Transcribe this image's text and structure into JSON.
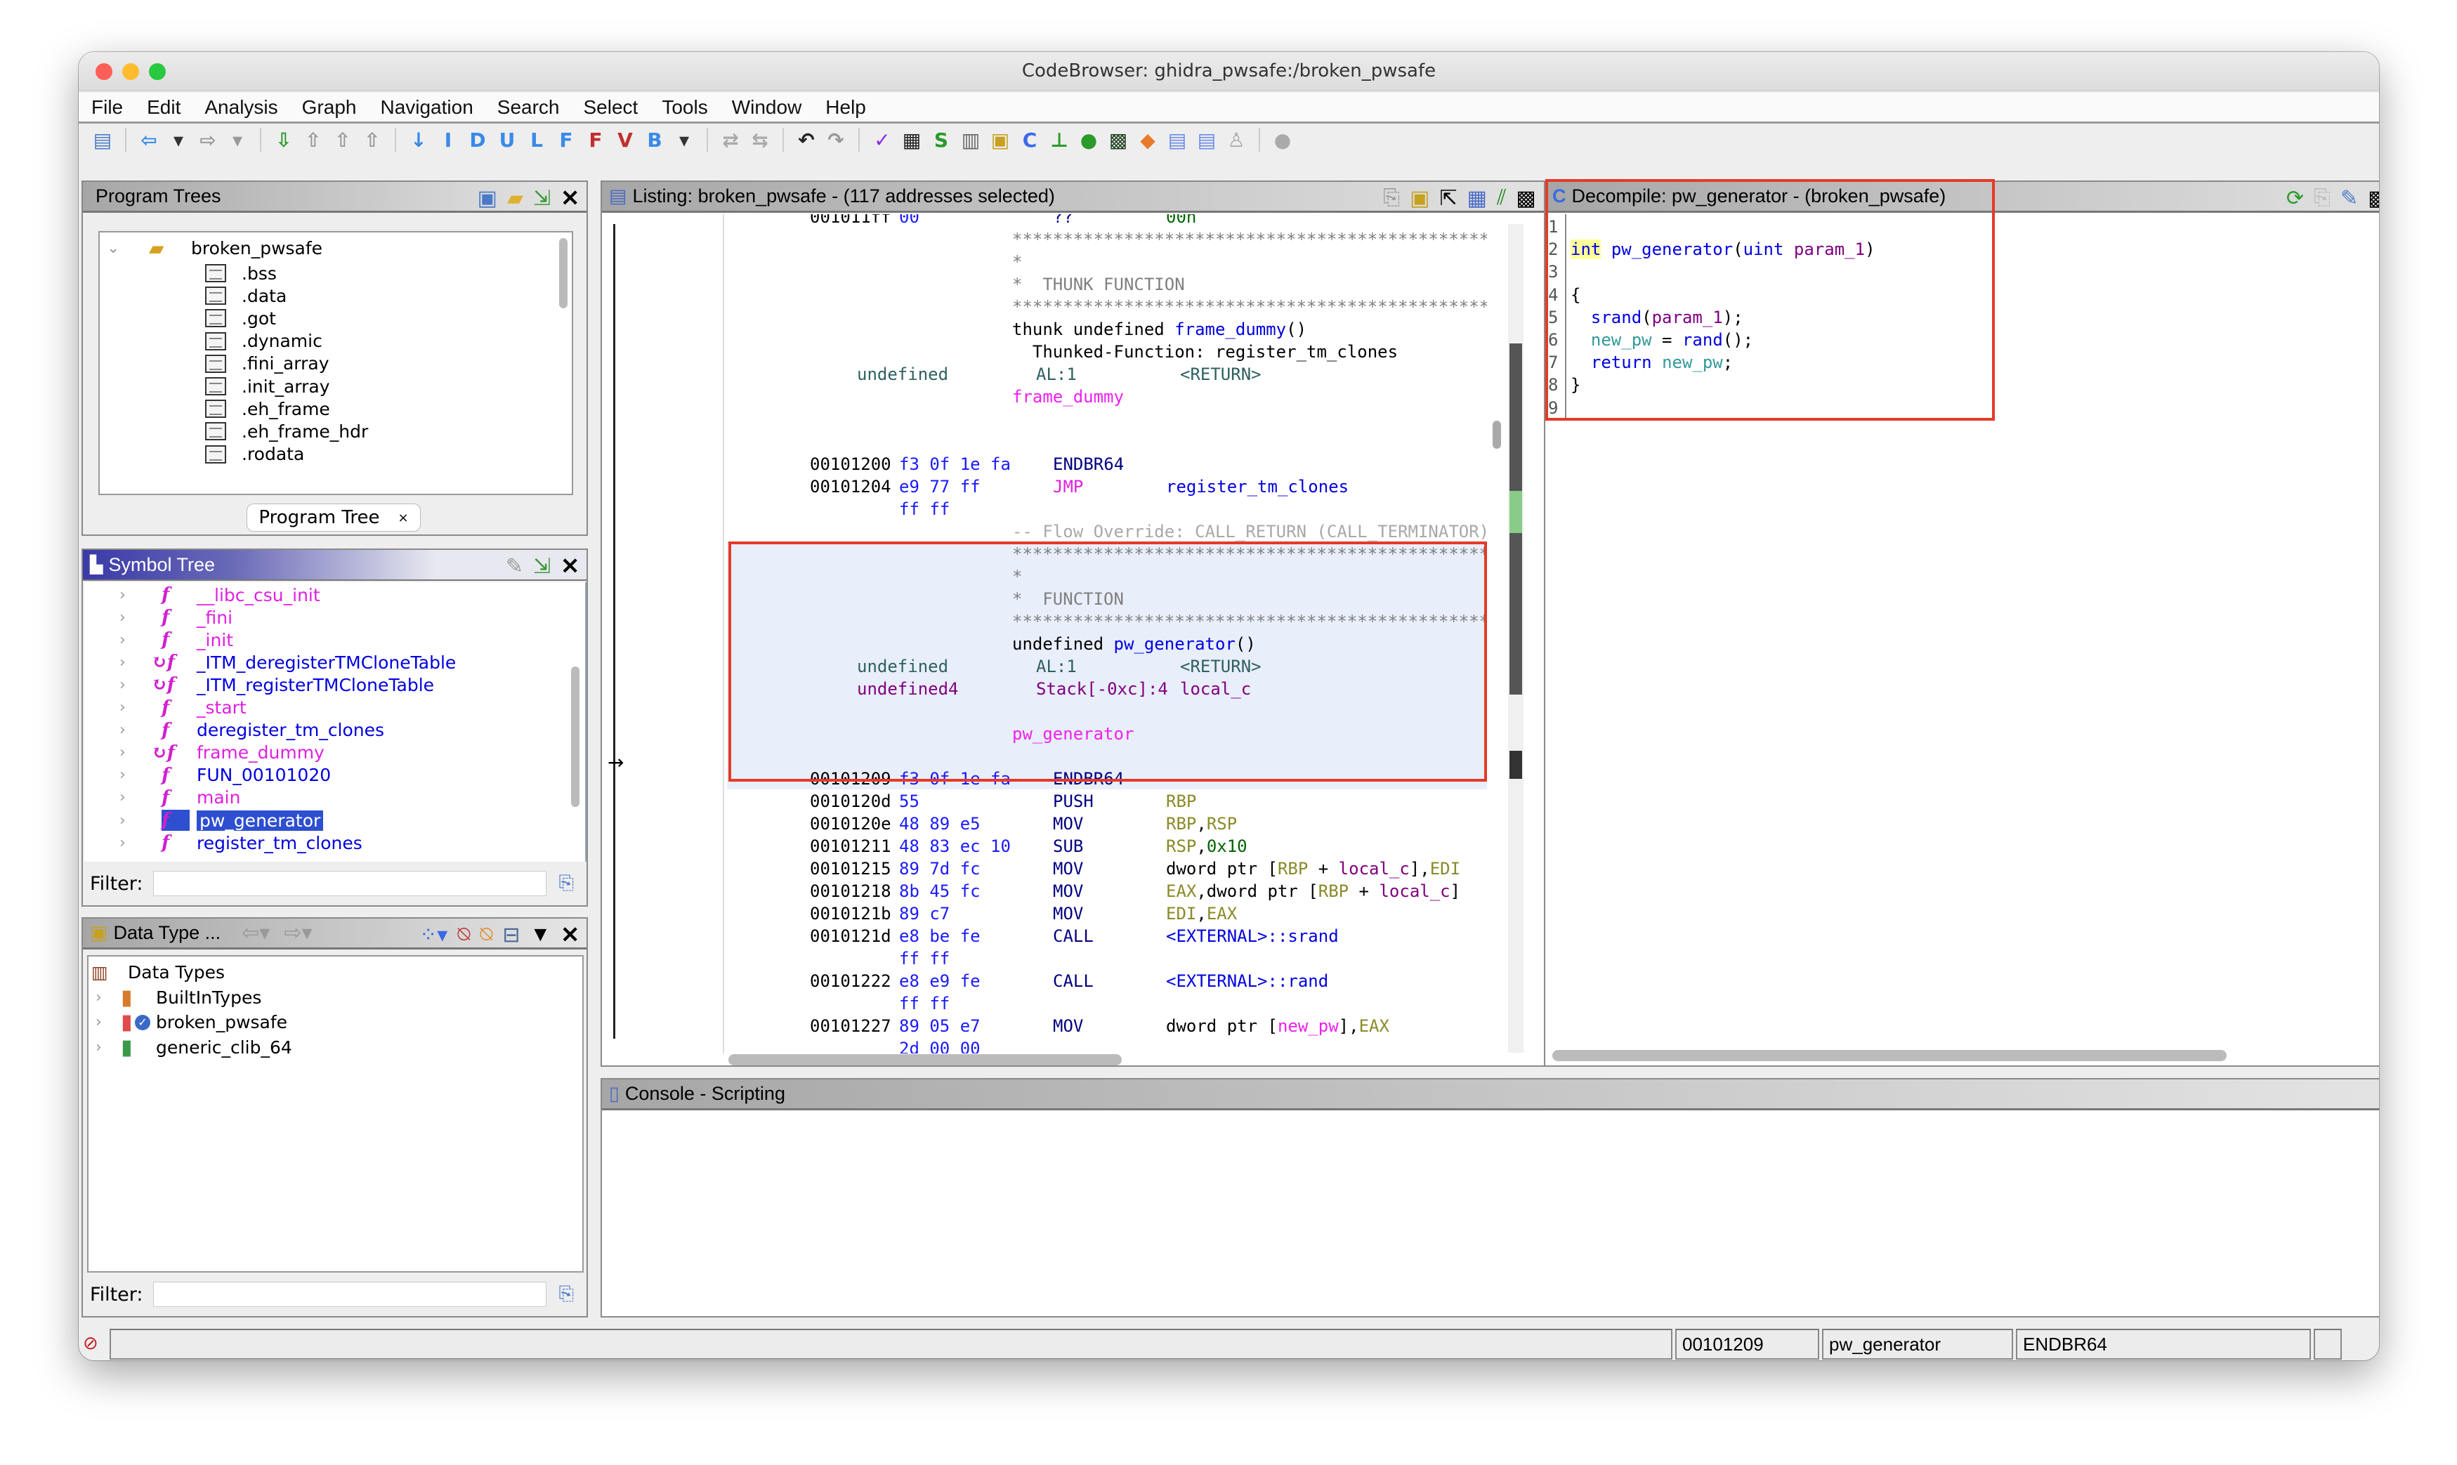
{
  "window": {
    "title": "CodeBrowser: ghidra_pwsafe:/broken_pwsafe"
  },
  "menu": [
    "File",
    "Edit",
    "Analysis",
    "Graph",
    "Navigation",
    "Search",
    "Select",
    "Tools",
    "Window",
    "Help"
  ],
  "toolbar": [
    {
      "icon": "save-icon",
      "g": "▤",
      "c": "#4a7ac8"
    },
    {
      "sep": true
    },
    {
      "icon": "back-icon",
      "g": "⇦",
      "c": "#3a8ae8"
    },
    {
      "icon": "dropdown-icon",
      "g": "▾",
      "c": "#333"
    },
    {
      "icon": "forward-icon",
      "g": "⇨",
      "c": "#999"
    },
    {
      "icon": "dropdown-icon",
      "g": "▾",
      "c": "#999"
    },
    {
      "sep": true
    },
    {
      "icon": "next-selected-icon",
      "g": "⇩",
      "c": "#2a9a2a"
    },
    {
      "icon": "next-icon",
      "g": "⇧",
      "c": "#999"
    },
    {
      "icon": "next-icon",
      "g": "⇧",
      "c": "#999"
    },
    {
      "icon": "next-icon",
      "g": "⇧",
      "c": "#999"
    },
    {
      "sep": true
    },
    {
      "icon": "down-arrow-icon",
      "g": "↓",
      "c": "#3a8ae8"
    },
    {
      "icon": "instruction-icon",
      "g": "I",
      "c": "#3a8ae8"
    },
    {
      "icon": "data-icon",
      "g": "D",
      "c": "#3a8ae8"
    },
    {
      "icon": "undefined-icon",
      "g": "U",
      "c": "#3a8ae8"
    },
    {
      "icon": "label-icon",
      "g": "L",
      "c": "#3a8ae8"
    },
    {
      "icon": "function-icon",
      "g": "F",
      "c": "#3a8ae8"
    },
    {
      "icon": "non-function-icon",
      "g": "F",
      "c": "#c03030"
    },
    {
      "icon": "value-icon",
      "g": "V",
      "c": "#c03030"
    },
    {
      "icon": "bookmark-icon",
      "g": "B",
      "c": "#3a8ae8"
    },
    {
      "icon": "dropdown-icon",
      "g": "▾",
      "c": "#333"
    },
    {
      "sep": true
    },
    {
      "icon": "merge-icon",
      "g": "⇄",
      "c": "#aaa"
    },
    {
      "icon": "split-icon",
      "g": "⇆",
      "c": "#aaa"
    },
    {
      "sep": true
    },
    {
      "icon": "undo-icon",
      "g": "↶",
      "c": "#222"
    },
    {
      "icon": "redo-icon",
      "g": "↷",
      "c": "#999"
    },
    {
      "sep": true
    },
    {
      "icon": "check-icon",
      "g": "✓",
      "c": "#8a2ae8"
    },
    {
      "icon": "bytes-icon",
      "g": "▦",
      "c": "#222"
    },
    {
      "icon": "script-icon",
      "g": "S",
      "c": "#2a9a2a"
    },
    {
      "icon": "memory-icon",
      "g": "▥",
      "c": "#666"
    },
    {
      "icon": "datatype-icon",
      "g": "▣",
      "c": "#c8a020"
    },
    {
      "icon": "decompile-icon",
      "g": "C",
      "c": "#3a6ae8"
    },
    {
      "icon": "graph-icon",
      "g": "⊥",
      "c": "#2a9a2a"
    },
    {
      "icon": "run-icon",
      "g": "●",
      "c": "#2a9a2a"
    },
    {
      "icon": "terminal-icon",
      "g": "▩",
      "c": "#224422"
    },
    {
      "icon": "diamond-icon",
      "g": "◆",
      "c": "#e87a2a"
    },
    {
      "icon": "table-icon",
      "g": "▤",
      "c": "#6a8ae8"
    },
    {
      "icon": "table-export-icon",
      "g": "▤",
      "c": "#6a8ae8"
    },
    {
      "icon": "tree-icon",
      "g": "♙",
      "c": "#aaa"
    },
    {
      "sep": true
    },
    {
      "icon": "help-icon",
      "g": "●",
      "c": "#aaa"
    }
  ],
  "program_trees": {
    "title": "Program Trees",
    "root": "broken_pwsafe",
    "items": [
      ".bss",
      ".data",
      ".got",
      ".dynamic",
      ".fini_array",
      ".init_array",
      ".eh_frame",
      ".eh_frame_hdr",
      ".rodata"
    ],
    "tab": "Program Tree",
    "tab_close": "×"
  },
  "symbol_tree": {
    "title": "Symbol Tree",
    "items": [
      {
        "label": "__libc_csu_init",
        "color": "#e020e0",
        "thunk": false
      },
      {
        "label": "_fini",
        "color": "#e020e0",
        "thunk": false
      },
      {
        "label": "_init",
        "color": "#e020e0",
        "thunk": false
      },
      {
        "label": "_ITM_deregisterTMCloneTable",
        "color": "#0000e0",
        "thunk": true
      },
      {
        "label": "_ITM_registerTMCloneTable",
        "color": "#0000e0",
        "thunk": true
      },
      {
        "label": "_start",
        "color": "#e020e0",
        "thunk": false
      },
      {
        "label": "deregister_tm_clones",
        "color": "#0000e0",
        "thunk": false
      },
      {
        "label": "frame_dummy",
        "color": "#e020e0",
        "thunk": true
      },
      {
        "label": "FUN_00101020",
        "color": "#0000e0",
        "thunk": false
      },
      {
        "label": "main",
        "color": "#e020e0",
        "thunk": false
      },
      {
        "label": "pw_generator",
        "color": "#ffffff",
        "thunk": false,
        "selected": true
      },
      {
        "label": "register_tm_clones",
        "color": "#0000e0",
        "thunk": false
      }
    ],
    "filter_label": "Filter:",
    "filter_value": ""
  },
  "data_types": {
    "title": "Data Type ...",
    "root": "Data Types",
    "items": [
      {
        "label": "BuiltInTypes",
        "color": "#d87a2a"
      },
      {
        "label": "broken_pwsafe",
        "color": "#e04a4a",
        "checked": true
      },
      {
        "label": "generic_clib_64",
        "color": "#3a9a4a"
      }
    ],
    "filter_label": "Filter:",
    "filter_value": ""
  },
  "listing": {
    "title": "Listing:  broken_pwsafe - (117 addresses selected)",
    "rows": [
      {
        "addr": "001011ff",
        "bytes": "00",
        "mnem": "??",
        "ops": [
          [
            "00h",
            "const"
          ]
        ]
      },
      {
        "plate": [
          [
            "**************************************************************",
            "stars"
          ]
        ]
      },
      {
        "plate": [
          [
            "*",
            "stars"
          ]
        ]
      },
      {
        "plate": [
          [
            "*  THUNK FUNCTION",
            "stars"
          ]
        ]
      },
      {
        "plate": [
          [
            "**************************************************************",
            "stars"
          ]
        ]
      },
      {
        "plate": [
          [
            "thunk undefined ",
            "plain"
          ],
          [
            "frame_dummy",
            "func"
          ],
          [
            "()",
            "plain"
          ]
        ]
      },
      {
        "plate": [
          [
            "  Thunked-Function: register_tm_clones",
            "plain"
          ]
        ]
      },
      {
        "type": "undefined",
        "storage": "AL:1",
        "ret": "<RETURN>"
      },
      {
        "plate": [
          [
            "frame_dummy",
            "label"
          ]
        ]
      },
      {},
      {},
      {
        "addr": "00101200",
        "bytes": "f3 0f 1e fa",
        "mnem": "ENDBR64"
      },
      {
        "addr": "00101204",
        "bytes": "e9 77 ff",
        "mnem": "JMP",
        "mk": "jmp",
        "ops": [
          [
            "register_tm_clones",
            "func"
          ]
        ]
      },
      {
        "bytes": "ff ff"
      },
      {
        "plate": [
          [
            "-- Flow Override: CALL_RETURN (CALL_TERMINATOR)",
            "flow"
          ]
        ]
      },
      {
        "sel": true,
        "plate": [
          [
            "**************************************************************",
            "stars"
          ]
        ]
      },
      {
        "sel": true,
        "plate": [
          [
            "*",
            "stars"
          ]
        ]
      },
      {
        "sel": true,
        "plate": [
          [
            "*  FUNCTION",
            "stars"
          ]
        ]
      },
      {
        "sel": true,
        "plate": [
          [
            "**************************************************************",
            "stars"
          ]
        ]
      },
      {
        "sel": true,
        "plate": [
          [
            "undefined ",
            "plain"
          ],
          [
            "pw_generator",
            "func"
          ],
          [
            "()",
            "plain"
          ]
        ]
      },
      {
        "sel": true,
        "type": "undefined",
        "storage": "AL:1",
        "ret": "<RETURN>"
      },
      {
        "sel": true,
        "type": "undefined4",
        "tk": "var",
        "storage": "Stack[-0xc]:4",
        "sk": "var",
        "ret": "local_c",
        "rk": "var"
      },
      {
        "sel": true
      },
      {
        "sel": true,
        "plate": [
          [
            "pw_generator",
            "label"
          ]
        ]
      },
      {
        "sel": true
      },
      {
        "sel": true,
        "addr": "00101209",
        "bytes": "f3 0f 1e fa",
        "mnem": "ENDBR64"
      },
      {
        "addr": "0010120d",
        "bytes": "55",
        "mnem": "PUSH",
        "ops": [
          [
            "RBP",
            "reg"
          ]
        ]
      },
      {
        "addr": "0010120e",
        "bytes": "48 89 e5",
        "mnem": "MOV",
        "ops": [
          [
            "RBP",
            "reg"
          ],
          [
            ",",
            "plain"
          ],
          [
            "RSP",
            "reg"
          ]
        ]
      },
      {
        "addr": "00101211",
        "bytes": "48 83 ec 10",
        "mnem": "SUB",
        "ops": [
          [
            "RSP",
            "reg"
          ],
          [
            ",",
            "plain"
          ],
          [
            "0x10",
            "const"
          ]
        ]
      },
      {
        "addr": "00101215",
        "bytes": "89 7d fc",
        "mnem": "MOV",
        "ops": [
          [
            "dword ptr [",
            "plain"
          ],
          [
            "RBP",
            "reg"
          ],
          [
            " + ",
            "plain"
          ],
          [
            "local_c",
            "var"
          ],
          [
            "],",
            "plain"
          ],
          [
            "EDI",
            "reg"
          ]
        ]
      },
      {
        "addr": "00101218",
        "bytes": "8b 45 fc",
        "mnem": "MOV",
        "ops": [
          [
            "EAX",
            "reg"
          ],
          [
            ",dword ptr [",
            "plain"
          ],
          [
            "RBP",
            "reg"
          ],
          [
            " + ",
            "plain"
          ],
          [
            "local_c",
            "var"
          ],
          [
            "]",
            "plain"
          ]
        ]
      },
      {
        "addr": "0010121b",
        "bytes": "89 c7",
        "mnem": "MOV",
        "ops": [
          [
            "EDI",
            "reg"
          ],
          [
            ",",
            "plain"
          ],
          [
            "EAX",
            "reg"
          ]
        ]
      },
      {
        "addr": "0010121d",
        "bytes": "e8 be fe",
        "mnem": "CALL",
        "ops": [
          [
            "<EXTERNAL>::srand",
            "ext"
          ]
        ]
      },
      {
        "bytes": "ff ff"
      },
      {
        "addr": "00101222",
        "bytes": "e8 e9 fe",
        "mnem": "CALL",
        "ops": [
          [
            "<EXTERNAL>::rand",
            "ext"
          ]
        ]
      },
      {
        "bytes": "ff ff"
      },
      {
        "addr": "00101227",
        "bytes": "89 05 e7",
        "mnem": "MOV",
        "ops": [
          [
            "dword ptr [",
            "plain"
          ],
          [
            "new_pw",
            "label"
          ],
          [
            "],",
            "plain"
          ],
          [
            "EAX",
            "reg"
          ]
        ]
      },
      {
        "bytes": "2d 00 00"
      }
    ]
  },
  "decompile": {
    "title": "Decompile: pw_generator -  (broken_pwsafe)",
    "lines": [
      {
        "n": "1",
        "code": []
      },
      {
        "n": "2",
        "code": [
          [
            "int",
            "kw hl"
          ],
          [
            " ",
            "plain"
          ],
          [
            "pw_generator",
            "fn"
          ],
          [
            "(",
            "plain"
          ],
          [
            "uint",
            "kw"
          ],
          [
            " ",
            "plain"
          ],
          [
            "param_1",
            "param"
          ],
          [
            ")",
            "plain"
          ]
        ]
      },
      {
        "n": "3",
        "code": []
      },
      {
        "n": "4",
        "code": [
          [
            "{",
            "plain"
          ]
        ]
      },
      {
        "n": "5",
        "code": [
          [
            "  ",
            "plain"
          ],
          [
            "srand",
            "fn"
          ],
          [
            "(",
            "plain"
          ],
          [
            "param_1",
            "param"
          ],
          [
            ");",
            "plain"
          ]
        ]
      },
      {
        "n": "6",
        "code": [
          [
            "  ",
            "plain"
          ],
          [
            "new_pw",
            "glob"
          ],
          [
            " = ",
            "plain"
          ],
          [
            "rand",
            "fn"
          ],
          [
            "();",
            "plain"
          ]
        ]
      },
      {
        "n": "7",
        "code": [
          [
            "  ",
            "plain"
          ],
          [
            "return",
            "kw"
          ],
          [
            " ",
            "plain"
          ],
          [
            "new_pw",
            "glob"
          ],
          [
            ";",
            "plain"
          ]
        ]
      },
      {
        "n": "8",
        "code": [
          [
            "}",
            "plain"
          ]
        ]
      },
      {
        "n": "9",
        "code": []
      }
    ]
  },
  "console": {
    "title": "Console - Scripting"
  },
  "status": {
    "address": "00101209",
    "function": "pw_generator",
    "instruction": "ENDBR64"
  },
  "colors": {
    "highlight_box": "#e53a28",
    "selection_bg": "#e8eefa",
    "selected_item": "#2d4fd0"
  }
}
